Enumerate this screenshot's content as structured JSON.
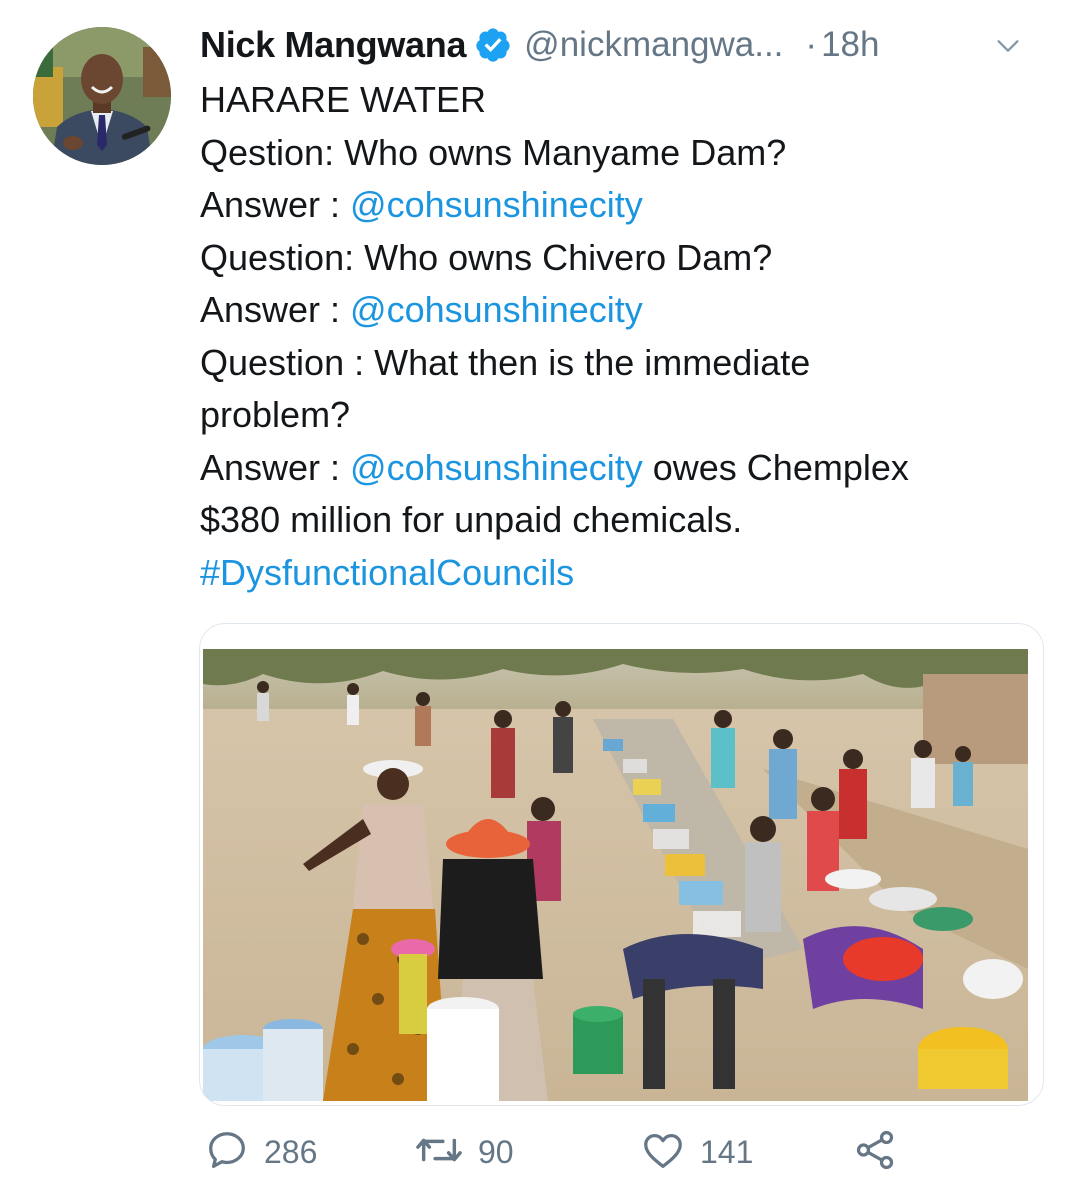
{
  "tweet": {
    "author": {
      "name": "Nick Mangwana",
      "handle": "@nickmangwa...",
      "verified": true,
      "avatar_icon": "profile-photo"
    },
    "separator": "·",
    "time": "18h",
    "menu_icon": "chevron-down-icon",
    "lines": [
      [
        {
          "t": "HARARE WATER"
        }
      ],
      [
        {
          "t": "Qestion: Who owns Manyame Dam?"
        }
      ],
      [
        {
          "t": "Answer : "
        },
        {
          "t": "@cohsunshinecity",
          "link": true
        }
      ],
      [
        {
          "t": "Question: Who owns Chivero Dam?"
        }
      ],
      [
        {
          "t": "Answer : "
        },
        {
          "t": "@cohsunshinecity",
          "link": true
        }
      ],
      [
        {
          "t": "Question : What then is the immediate"
        }
      ],
      [
        {
          "t": "problem?"
        }
      ],
      [
        {
          "t": "Answer : "
        },
        {
          "t": "@cohsunshinecity",
          "link": true
        },
        {
          "t": " owes Chemplex"
        }
      ],
      [
        {
          "t": "$380 million for unpaid chemicals."
        }
      ],
      [
        {
          "t": "#DysfunctionalCouncils",
          "link": true
        }
      ]
    ],
    "media": {
      "type": "photo",
      "icon": "photo-of-people-queuing-for-water"
    },
    "actions": {
      "replies": "286",
      "retweets": "90",
      "likes": "141"
    }
  },
  "colors": {
    "link": "#1b95e0",
    "secondary_text": "#657786",
    "verified_badge": "#1da1f2",
    "border": "#e1e8ed"
  }
}
